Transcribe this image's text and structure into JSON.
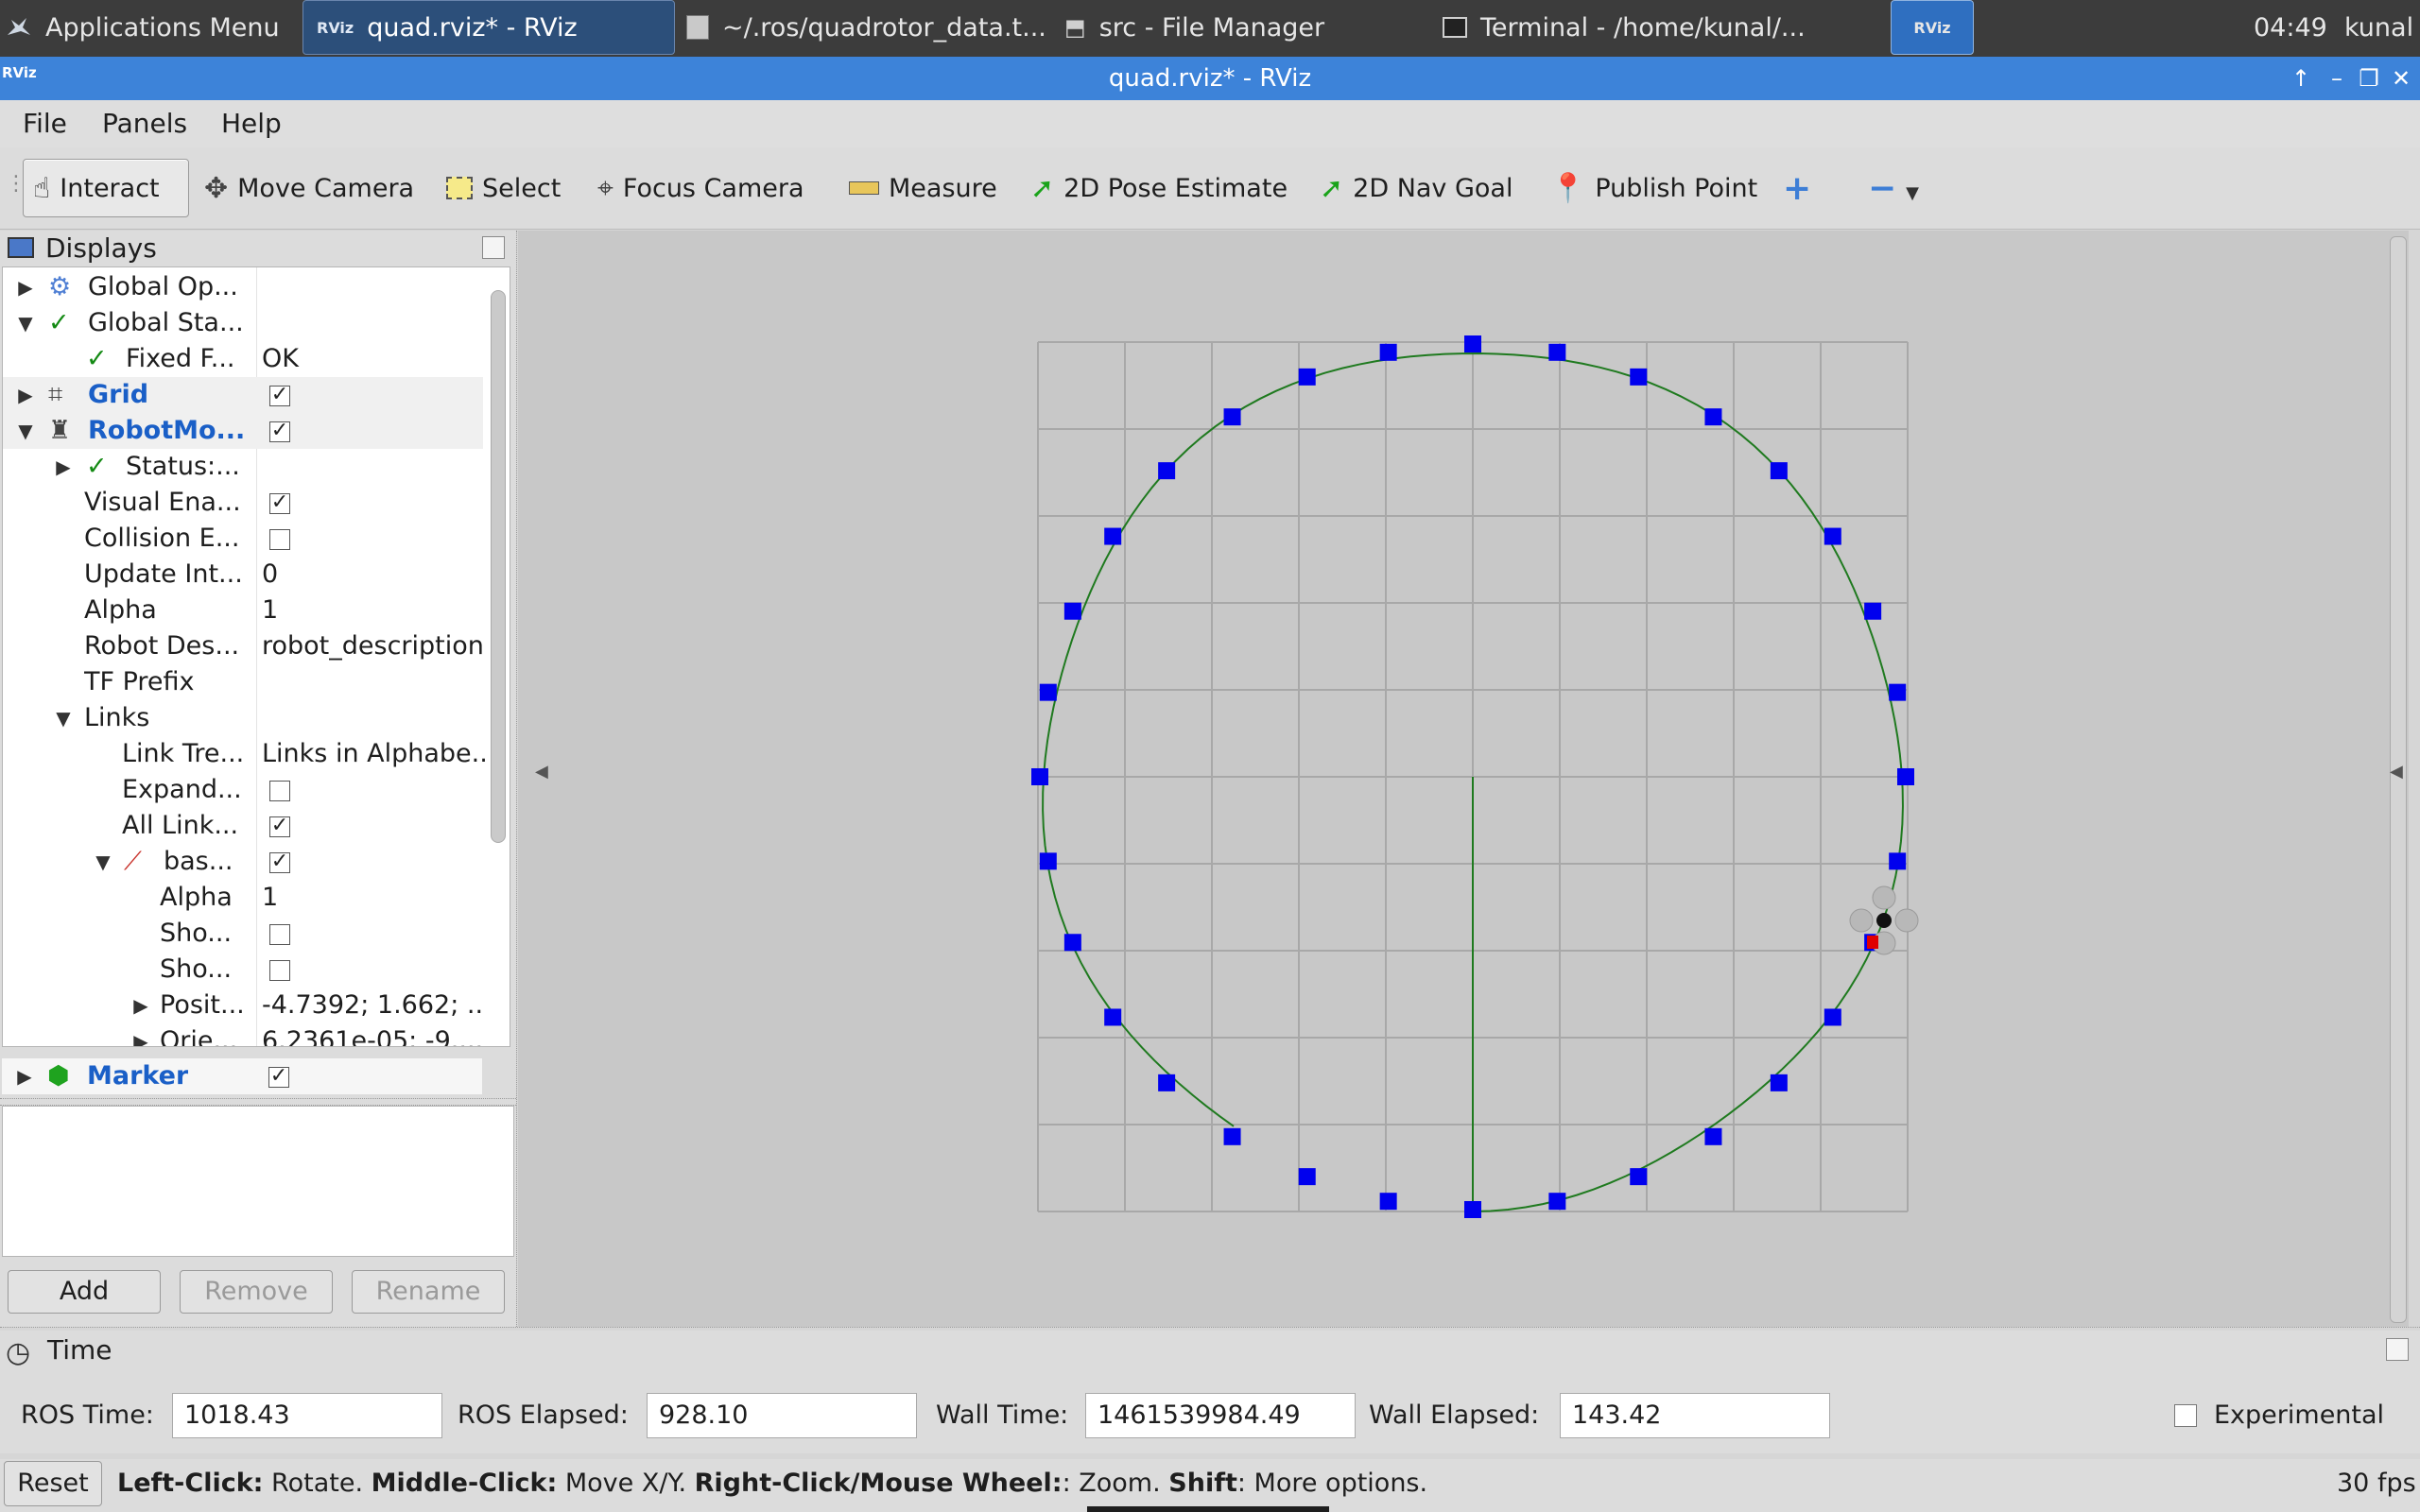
{
  "taskbar": {
    "apps_menu": "Applications Menu",
    "windows": [
      {
        "label": "quad.rviz* - RViz",
        "active": true
      },
      {
        "label": "~/.ros/quadrotor_data.t...",
        "active": false
      },
      {
        "label": "src - File Manager",
        "active": false
      },
      {
        "label": "Terminal - /home/kunal/...",
        "active": false
      }
    ],
    "workspace_label": "RViz",
    "clock": "04:49",
    "user": "kunal"
  },
  "window": {
    "title": "quad.rviz* - RViz",
    "logo": "RViz"
  },
  "menu": {
    "file": "File",
    "panels": "Panels",
    "help": "Help"
  },
  "toolbar": {
    "interact": "Interact",
    "move_camera": "Move Camera",
    "select": "Select",
    "focus_camera": "Focus Camera",
    "measure": "Measure",
    "pose_estimate": "2D Pose Estimate",
    "nav_goal": "2D Nav Goal",
    "publish_point": "Publish Point"
  },
  "displays": {
    "title": "Displays",
    "rows": [
      {
        "name": "Global Op...",
        "value": ""
      },
      {
        "name": "Global Sta...",
        "value": ""
      },
      {
        "name": "Fixed F...",
        "value": "OK"
      },
      {
        "name": "Grid",
        "value": ""
      },
      {
        "name": "RobotMo...",
        "value": ""
      },
      {
        "name": "Status:...",
        "value": ""
      },
      {
        "name": "Visual Ena...",
        "value": ""
      },
      {
        "name": "Collision E...",
        "value": ""
      },
      {
        "name": "Update Int...",
        "value": "0"
      },
      {
        "name": "Alpha",
        "value": "1"
      },
      {
        "name": "Robot Des...",
        "value": "robot_description"
      },
      {
        "name": "TF Prefix",
        "value": ""
      },
      {
        "name": "Links",
        "value": ""
      },
      {
        "name": "Link Tre...",
        "value": "Links in Alphabe..."
      },
      {
        "name": "Expand...",
        "value": ""
      },
      {
        "name": "All Link...",
        "value": ""
      },
      {
        "name": "bas...",
        "value": ""
      },
      {
        "name": "Alpha",
        "value": "1"
      },
      {
        "name": "Sho...",
        "value": ""
      },
      {
        "name": "Sho...",
        "value": ""
      },
      {
        "name": "Posit...",
        "value": "-4.7392; 1.662; ..."
      },
      {
        "name": "Orie...",
        "value": "6.2361e-05; -9...."
      },
      {
        "name": "Marker",
        "value": ""
      }
    ],
    "buttons": {
      "add": "Add",
      "remove": "Remove",
      "rename": "Rename"
    }
  },
  "time": {
    "title": "Time",
    "ros_time_label": "ROS Time:",
    "ros_time": "1018.43",
    "ros_elapsed_label": "ROS Elapsed:",
    "ros_elapsed": "928.10",
    "wall_time_label": "Wall Time:",
    "wall_time": "1461539984.49",
    "wall_elapsed_label": "Wall Elapsed:",
    "wall_elapsed": "143.42",
    "experimental": "Experimental"
  },
  "status": {
    "reset": "Reset",
    "hint_left_bold": "Left-Click:",
    "hint_left": " Rotate. ",
    "hint_middle_bold": "Middle-Click:",
    "hint_middle": " Move X/Y. ",
    "hint_right_bold": "Right-Click/Mouse Wheel:",
    "hint_right": ": Zoom. ",
    "hint_shift_bold": "Shift",
    "hint_shift": ": More options.",
    "fps": "30 fps"
  },
  "colors": {
    "accent": "#3d83d9",
    "link_blue": "#1a5fc7",
    "marker_blue": "#0000ee",
    "path_green": "#1f7a1f"
  }
}
